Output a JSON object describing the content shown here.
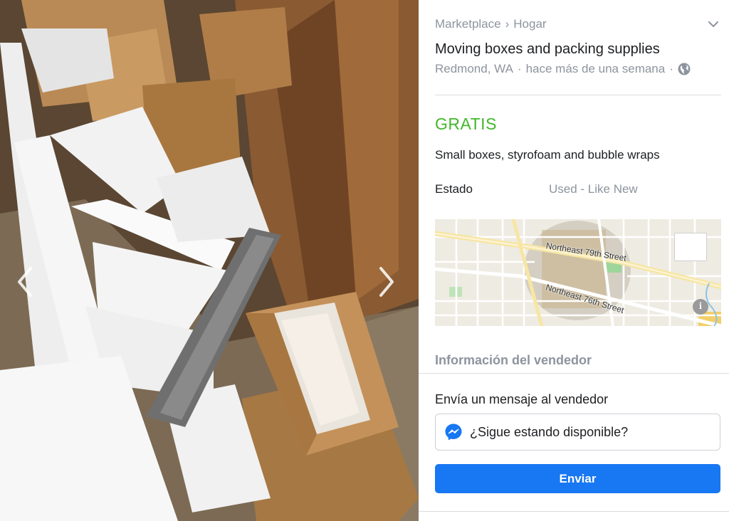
{
  "breadcrumb": {
    "root": "Marketplace",
    "separator": "›",
    "category": "Hogar"
  },
  "listing": {
    "title": "Moving boxes and packing supplies",
    "location": "Redmond, WA",
    "time": "hace más de una semana",
    "meta_separator": "·",
    "price": "GRATIS",
    "description": "Small boxes, styrofoam and bubble wraps",
    "condition_label": "Estado",
    "condition_value": "Used - Like New"
  },
  "map": {
    "street_1": "Northeast 79th Street",
    "street_2": "Northeast 76th Street",
    "expand_icon": "expand-icon",
    "info_icon": "info-icon",
    "info_glyph": "i"
  },
  "seller": {
    "heading": "Información del vendedor"
  },
  "message": {
    "heading": "Envía un mensaje al vendedor",
    "input_value": "¿Sigue estando disponible?",
    "send_label": "Enviar"
  },
  "colors": {
    "accent": "#1877f2",
    "price": "#42b72a",
    "secondary_text": "#8d949e",
    "primary_text": "#1c1e21"
  },
  "icons": {
    "prev": "chevron-left-icon",
    "next": "chevron-right-icon",
    "collapse": "chevron-down-icon",
    "privacy": "globe-icon",
    "messenger": "messenger-icon"
  }
}
